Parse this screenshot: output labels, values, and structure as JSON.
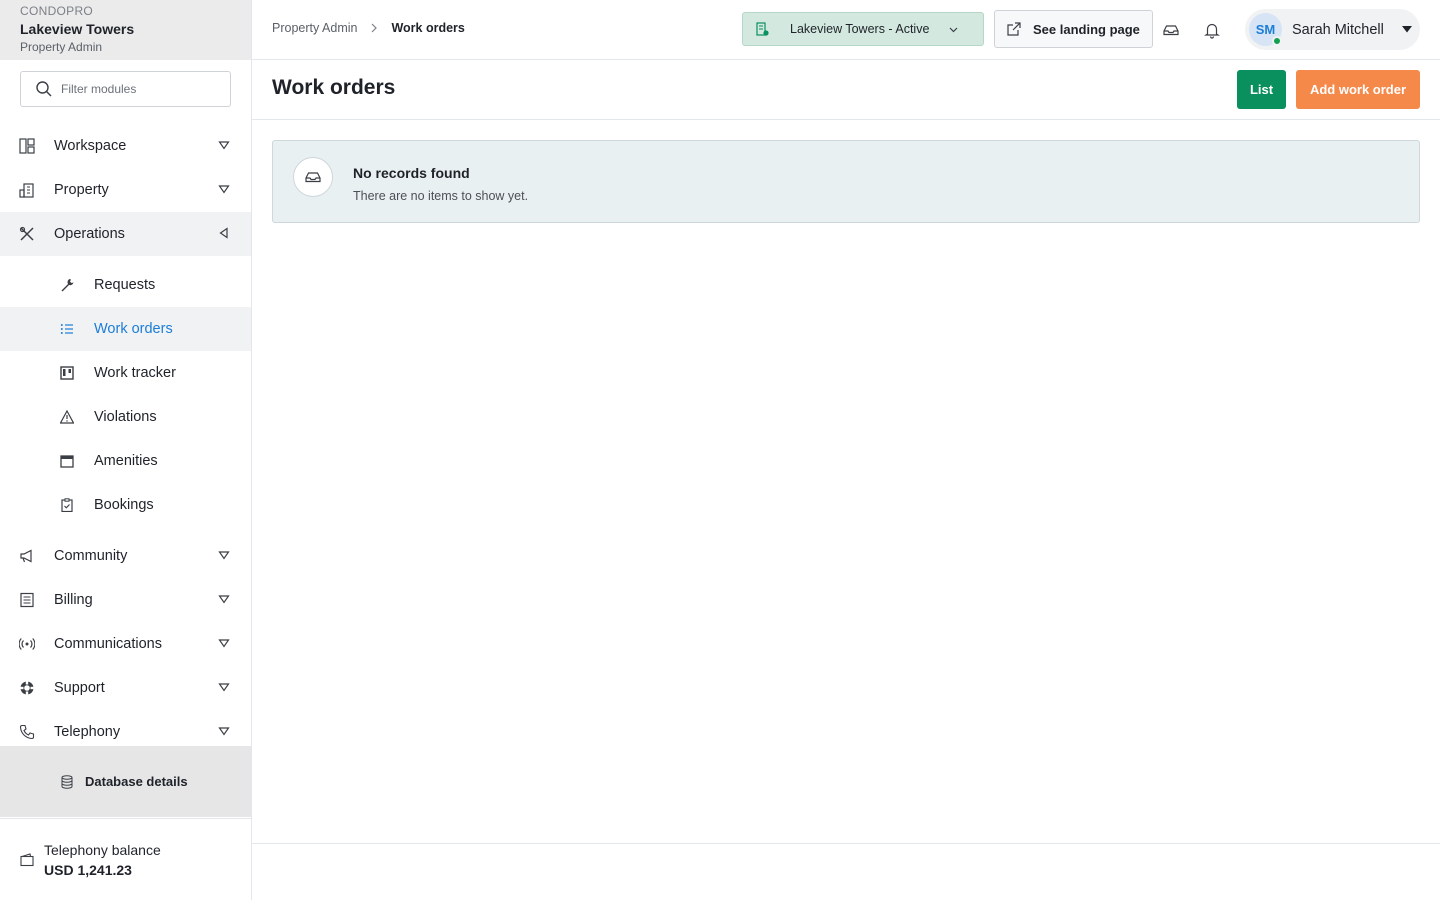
{
  "brand": {
    "app_name": "CONDOPRO",
    "org_name": "Lakeview Towers",
    "role": "Property Admin"
  },
  "filter": {
    "placeholder": "Filter modules"
  },
  "sidebar": {
    "items": [
      {
        "label": "Workspace",
        "icon": "layout-icon"
      },
      {
        "label": "Property",
        "icon": "building-icon"
      },
      {
        "label": "Operations",
        "icon": "tools-icon"
      }
    ],
    "operations_sub": [
      {
        "label": "Requests",
        "icon": "wrench-icon"
      },
      {
        "label": "Work orders",
        "icon": "list-icon"
      },
      {
        "label": "Work tracker",
        "icon": "kanban-icon"
      },
      {
        "label": "Violations",
        "icon": "warning-icon"
      },
      {
        "label": "Amenities",
        "icon": "calendar-icon"
      },
      {
        "label": "Bookings",
        "icon": "clipboard-icon"
      }
    ],
    "items_after": [
      {
        "label": "Community",
        "icon": "megaphone-icon"
      },
      {
        "label": "Billing",
        "icon": "receipt-icon"
      },
      {
        "label": "Communications",
        "icon": "broadcast-icon"
      },
      {
        "label": "Support",
        "icon": "lifebuoy-icon"
      },
      {
        "label": "Telephony",
        "icon": "phone-icon"
      }
    ],
    "database_label": "Database details",
    "balance_label": "Telephony balance",
    "balance_value": "USD 1,241.23"
  },
  "topbar": {
    "breadcrumb_root": "Property Admin",
    "breadcrumb_current": "Work orders",
    "property_select": "Lakeview Towers - Active",
    "landing_label": "See landing page",
    "user_initials": "SM",
    "user_name": "Sarah Mitchell"
  },
  "page": {
    "title": "Work orders",
    "list_button": "List",
    "add_button": "Add work order",
    "empty_title": "No records found",
    "empty_desc": "There are no items to show yet."
  },
  "colors": {
    "active_link": "#1c7ed6",
    "primary_green": "#0a8f5e",
    "accent_orange": "#f5894a",
    "status_online": "#12a150"
  }
}
